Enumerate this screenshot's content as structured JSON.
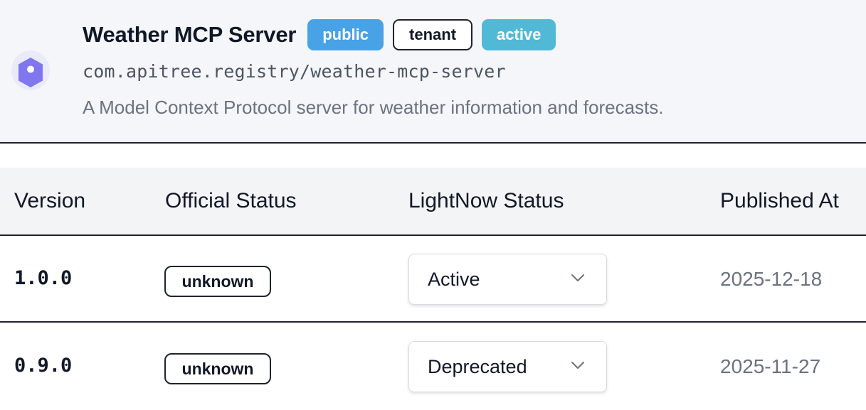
{
  "server": {
    "title": "Weather MCP Server",
    "badges": [
      "public",
      "tenant",
      "active"
    ],
    "id": "com.apitree.registry/weather-mcp-server",
    "description": "A Model Context Protocol server for weather information and forecasts.",
    "logo_icon": "hexagon-location-pin-icon"
  },
  "table": {
    "headers": [
      "Version",
      "Official Status",
      "LightNow Status",
      "Published At"
    ],
    "rows": [
      {
        "version": "1.0.0",
        "official_status": "unknown",
        "lightnow_status": "Active",
        "published_at": "2025-12-18"
      },
      {
        "version": "0.9.0",
        "official_status": "unknown",
        "lightnow_status": "Deprecated",
        "published_at": "2025-11-27"
      }
    ]
  },
  "colors": {
    "public_badge": "#48a2e6",
    "active_badge": "#51b9d6",
    "logo": "#8076ef",
    "header_bg": "#f5f6f9"
  }
}
